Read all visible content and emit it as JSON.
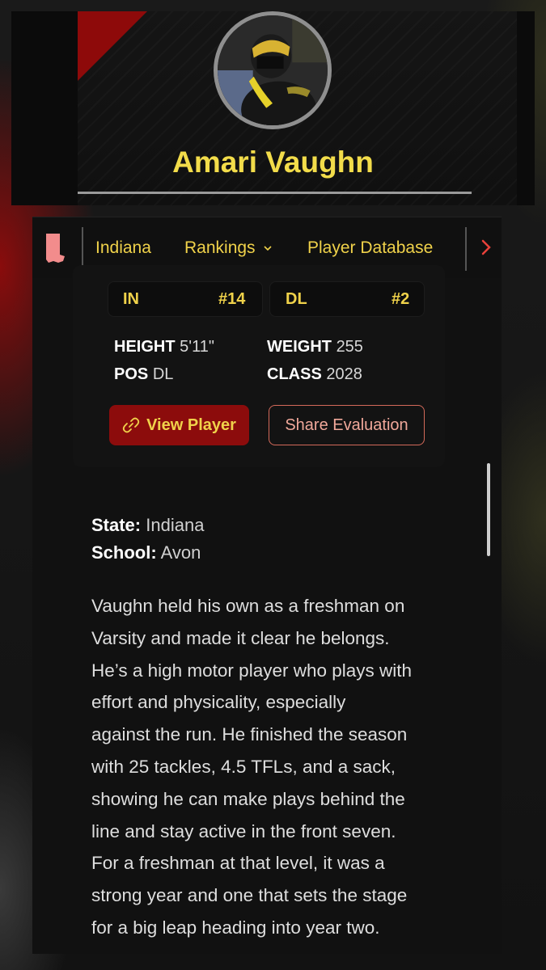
{
  "player": {
    "name": "Amari Vaughn"
  },
  "nav": {
    "items": [
      {
        "label": "Indiana"
      },
      {
        "label": "Rankings",
        "has_dropdown": true
      },
      {
        "label": "Player Database"
      }
    ],
    "state_icon": "indiana-state-icon",
    "more_icon": "chevron-right-icon"
  },
  "rankings": {
    "state": {
      "label": "IN",
      "rank": "#14"
    },
    "position": {
      "label": "DL",
      "rank": "#2"
    }
  },
  "stats": {
    "height": {
      "label": "HEIGHT",
      "value": "5'11\""
    },
    "weight": {
      "label": "WEIGHT",
      "value": "255"
    },
    "pos": {
      "label": "POS",
      "value": "DL"
    },
    "class": {
      "label": "CLASS",
      "value": "2028"
    }
  },
  "actions": {
    "view_player": "View Player",
    "share_evaluation": "Share Evaluation"
  },
  "info": {
    "state_label": "State:",
    "state_value": "Indiana",
    "school_label": "School:",
    "school_value": "Avon"
  },
  "evaluation": {
    "lines": [
      "Vaughn held his own as a freshman on",
      "Varsity and made it clear he belongs.",
      "He’s a high motor player who plays with",
      "effort and physicality, especially",
      "against the run. He finished the season",
      "with 25 tackles, 4.5 TFLs, and a sack,",
      "showing he can make plays behind the",
      "line and stay active in the front seven.",
      "For a freshman at that level, it was a",
      "strong year and one that sets the stage",
      "for a big leap heading into year two."
    ]
  },
  "colors": {
    "accent_yellow": "#f0d24a",
    "brand_red": "#8c0c0c",
    "share_border": "#d46a5a",
    "background": "#111111"
  }
}
